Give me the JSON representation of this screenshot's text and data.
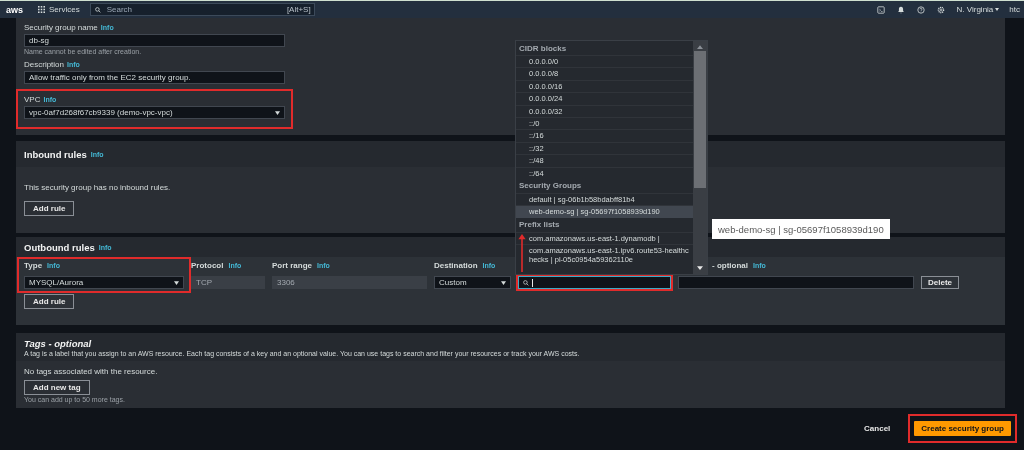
{
  "top_nav": {
    "logo": "aws",
    "services": "Services",
    "search": {
      "placeholder": "Search",
      "shortcut": "[Alt+S]"
    },
    "region": "N. Virginia",
    "account": "htc"
  },
  "details": {
    "fields": [
      {
        "kind": "text",
        "label": "Security group name",
        "info": "Info",
        "value": "db-sg",
        "hint": "Name cannot be edited after creation."
      },
      {
        "kind": "text",
        "label": "Description",
        "info": "Info",
        "value": "Allow traffic only from the EC2 security group."
      },
      {
        "kind": "select",
        "label": "VPC",
        "info": "Info",
        "value": "vpc-0af7d268f67cb9339 (demo-vpc-vpc)"
      }
    ]
  },
  "inbound": {
    "title": "Inbound rules",
    "info": "Info",
    "empty_text": "This security group has no inbound rules.",
    "add_button": "Add rule"
  },
  "outbound": {
    "title": "Outbound rules",
    "info": "Info",
    "columns": [
      {
        "label": "Type",
        "info": "Info"
      },
      {
        "label": "Protocol",
        "info": "Info"
      },
      {
        "label": "Port range",
        "info": "Info"
      },
      {
        "label": "Destination",
        "info": "Info"
      },
      {
        "label": "- optional",
        "info": "Info"
      }
    ],
    "rule": {
      "type": "MYSQL/Aurora",
      "protocol": {
        "value": "TCP",
        "disabled": true
      },
      "port_range": {
        "value": "3306",
        "disabled": true
      },
      "destination": "Custom",
      "delete_button": "Delete"
    },
    "add_button": "Add rule"
  },
  "tags": {
    "title": "Tags - optional",
    "description": "A tag is a label that you assign to an AWS resource. Each tag consists of a key and an optional value. You can use tags to search and filter your resources or track your AWS costs.",
    "empty_text": "No tags associated with the resource.",
    "add_button": "Add new tag",
    "hint": "You can add up to 50 more tags."
  },
  "footer": {
    "cancel": "Cancel",
    "create": "Create security group"
  },
  "destination_dropdown": {
    "groups": [
      {
        "label": "CIDR blocks",
        "items": [
          {
            "label": "0.0.0.0/0",
            "selected": false
          },
          {
            "label": "0.0.0.0/8",
            "selected": false
          },
          {
            "label": "0.0.0.0/16",
            "selected": false
          },
          {
            "label": "0.0.0.0/24",
            "selected": false
          },
          {
            "label": "0.0.0.0/32",
            "selected": false
          },
          {
            "label": "::/0",
            "selected": false
          },
          {
            "label": "::/16",
            "selected": false
          },
          {
            "label": "::/32",
            "selected": false
          },
          {
            "label": "::/48",
            "selected": false
          },
          {
            "label": "::/64",
            "selected": false
          }
        ]
      },
      {
        "label": "Security Groups",
        "items": [
          {
            "label": "default | sg-06b1b58bdabff81b4",
            "selected": false
          },
          {
            "label": "web-demo-sg | sg-05697f1058939d190",
            "selected": true
          }
        ]
      },
      {
        "label": "Prefix lists",
        "items": [
          {
            "label": "com.amazonaws.us-east-1.dynamodb |",
            "selected": false
          },
          {
            "label": "com.amazonaws.us-east-1.ipv6.route53-healthchecks | pl-05c0954a59362110e",
            "selected": false
          }
        ]
      }
    ]
  },
  "tooltip": "web-demo-sg | sg-05697f1058939d190"
}
